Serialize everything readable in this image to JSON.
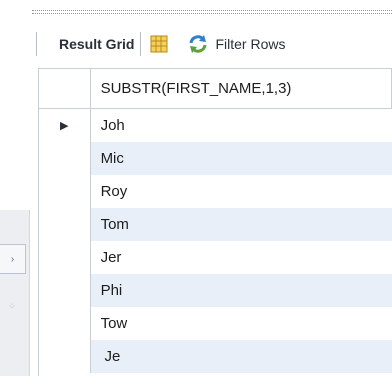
{
  "toolbar": {
    "result_grid_label": "Result Grid",
    "filter_label": "Filter Rows"
  },
  "grid": {
    "column_header": "SUBSTR(FIRST_NAME,1,3)",
    "rows": [
      "Joh",
      "Mic",
      "Roy",
      "Tom",
      "Jer",
      "Phi",
      "Tow",
      " Je"
    ],
    "selected_row_index": 0,
    "selected_row_marker": "▶"
  },
  "side": {
    "collapse_glyph": "›",
    "grip_glyph": "⁘"
  },
  "colors": {
    "alt_row": "#e9eff8",
    "grid_line": "#c9cdd4",
    "text": "#1d1d1d"
  }
}
